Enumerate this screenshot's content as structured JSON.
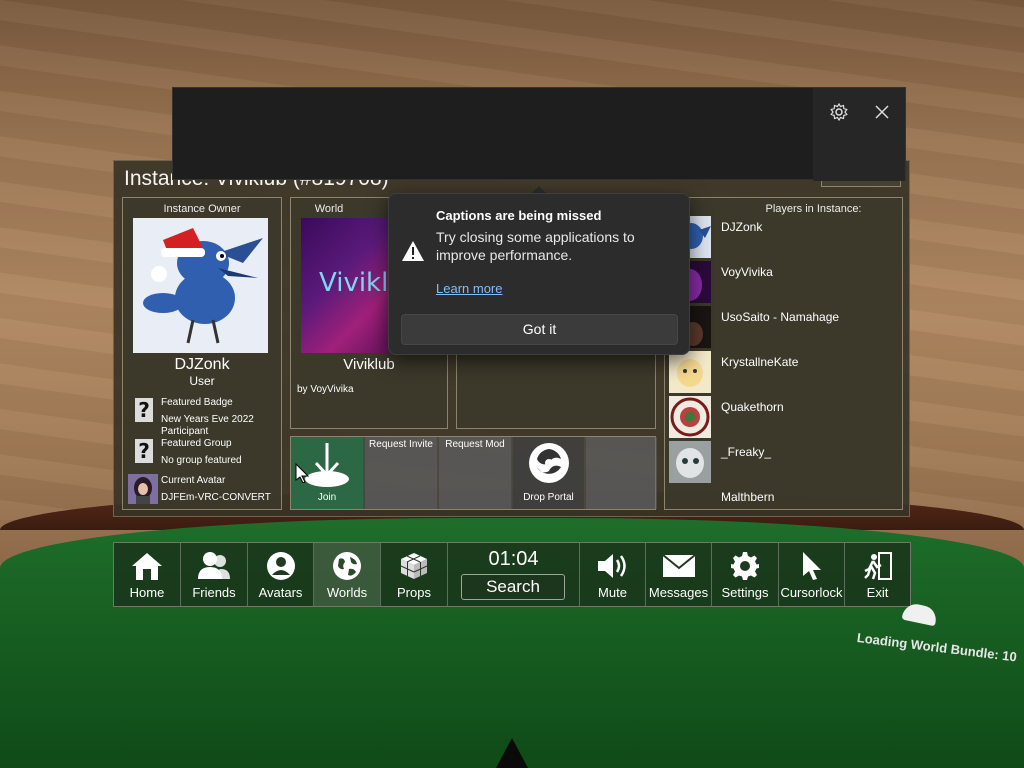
{
  "instance": {
    "title": "Instance: Viviklub (#819708)"
  },
  "owner": {
    "header": "Instance Owner",
    "name": "DJZonk",
    "role": "User",
    "badge_label": "Featured Badge",
    "badge_name": "New Years Eve 2022 Participant",
    "group_label": "Featured Group",
    "group_name": "No group featured",
    "avatar_label": "Current Avatar",
    "avatar_name": "DJFEm-VRC-CONVERT"
  },
  "world": {
    "header": "World",
    "name": "Viviklub",
    "author": "by VoyVivika",
    "logo_text": "Viviklub"
  },
  "actions": [
    {
      "label": "Join"
    },
    {
      "label": "Request Invite"
    },
    {
      "label": "Request Mod"
    },
    {
      "label": "Drop Portal"
    }
  ],
  "players": {
    "header": "Players in Instance:",
    "list": [
      "DJZonk",
      "VoyVivika",
      "UsoSaito - Namahage",
      "KrystallneKate",
      "Quakethorn",
      "_Freaky_",
      "Malthbern"
    ]
  },
  "toast": {
    "title": "Captions are being missed",
    "body": "Try closing some applications to improve performance.",
    "link": "Learn more",
    "button": "Got it"
  },
  "menu": {
    "items": [
      "Home",
      "Friends",
      "Avatars",
      "Worlds",
      "Props"
    ],
    "time": "01:04",
    "search": "Search",
    "items_right": [
      "Mute",
      "Messages",
      "Settings",
      "Cursorlock",
      "Exit"
    ]
  },
  "status": {
    "loading": "Loading World Bundle: 10"
  }
}
